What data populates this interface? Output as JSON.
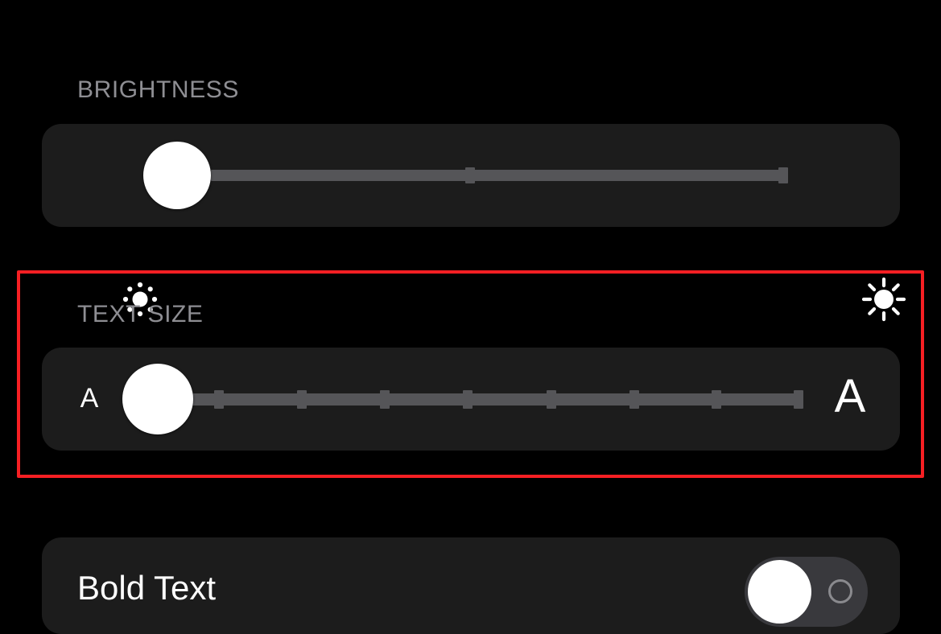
{
  "screen": {
    "background_color": "#000000",
    "card_color": "#1c1c1c",
    "track_color": "#555558",
    "thumb_color": "#ffffff",
    "header_text_color": "#8e8e93",
    "highlight_color": "#f61f23"
  },
  "brightness": {
    "header": "BRIGHTNESS",
    "min_icon": "sun-small-icon",
    "max_icon": "sun-large-icon",
    "slider": {
      "value_percent": 6,
      "tick_positions_percent": [
        45,
        100
      ],
      "thumb_label": "brightness-slider-thumb"
    }
  },
  "text_size": {
    "header": "TEXT SIZE",
    "min_label": "A",
    "max_label": "A",
    "slider": {
      "value_step": 0,
      "steps": 8,
      "tick_positions_percent": [
        5,
        18,
        32,
        45,
        59,
        72,
        86,
        100
      ],
      "thumb_label": "text-size-slider-thumb"
    }
  },
  "bold_text": {
    "label": "Bold Text",
    "toggle_state": "off",
    "toggle_off_indicator": "circle-outline-icon"
  },
  "annotation": {
    "target_section": "TEXT SIZE",
    "border_color": "#f61f23",
    "border_width_px": 4
  }
}
